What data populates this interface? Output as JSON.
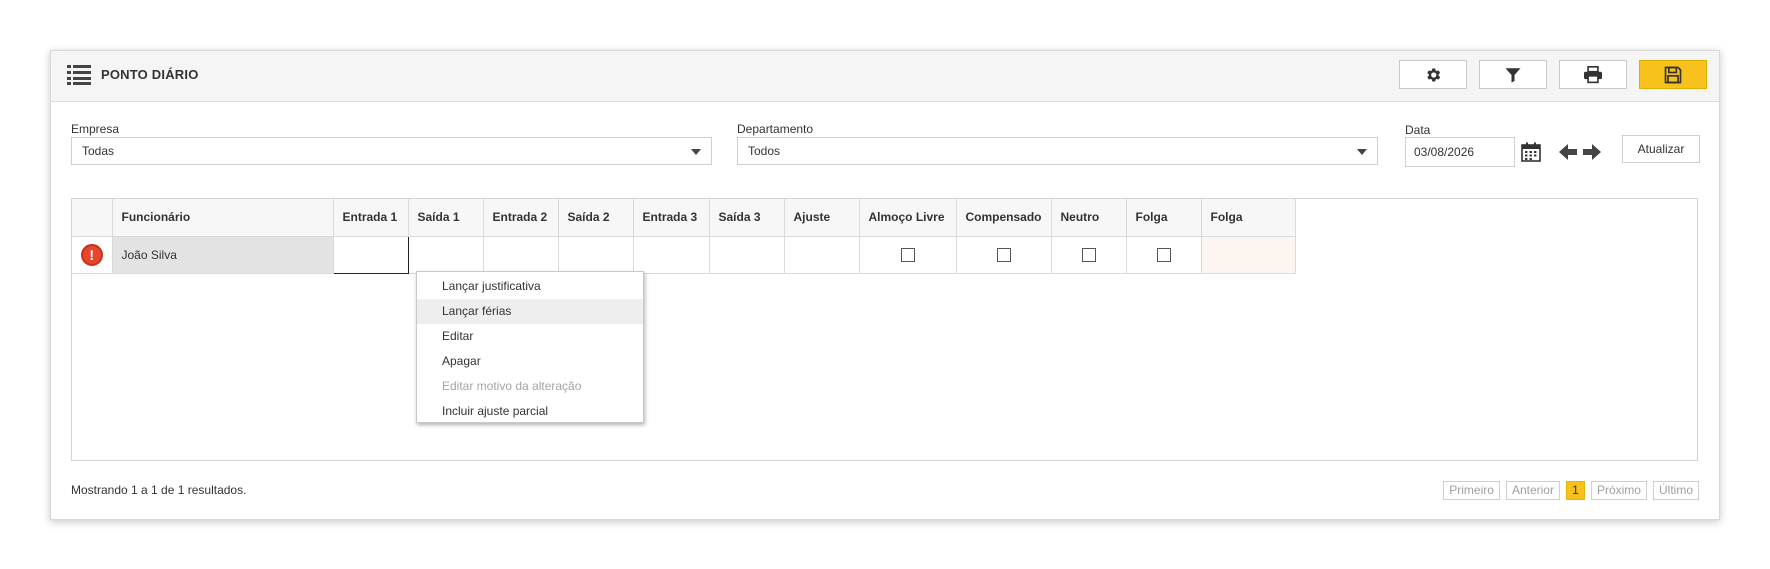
{
  "header": {
    "title": "PONTO DIÁRIO",
    "buttons": [
      {
        "icon": "gear-icon"
      },
      {
        "icon": "filter-icon"
      },
      {
        "icon": "print-icon"
      },
      {
        "icon": "save-icon"
      }
    ]
  },
  "filters": {
    "empresa": {
      "label": "Empresa",
      "value": "Todas"
    },
    "departamento": {
      "label": "Departamento",
      "value": "Todos"
    },
    "data": {
      "label": "Data",
      "value": "03/08/2026"
    },
    "refresh_label": "Atualizar"
  },
  "table": {
    "columns": [
      "",
      "Funcionário",
      "Entrada 1",
      "Saída 1",
      "Entrada 2",
      "Saída 2",
      "Entrada 3",
      "Saída 3",
      "Ajuste",
      "Almoço Livre",
      "Compensado",
      "Neutro",
      "Folga",
      "Folga"
    ],
    "rows": [
      {
        "status_icon": "alert-icon",
        "status_glyph": "!",
        "funcionario": "João Silva",
        "entrada1": "",
        "saida1": "",
        "entrada2": "",
        "saida2": "",
        "entrada3": "",
        "saida3": "",
        "ajuste": "",
        "almoco_livre": false,
        "compensado": false,
        "neutro": false,
        "folga": false,
        "folga2": ""
      }
    ]
  },
  "context_menu": {
    "items": [
      {
        "label": "Lançar justificativa",
        "state": "normal"
      },
      {
        "label": "Lançar férias",
        "state": "hover"
      },
      {
        "label": "Editar",
        "state": "normal"
      },
      {
        "label": "Apagar",
        "state": "normal"
      },
      {
        "label": "Editar motivo da alteração",
        "state": "disabled"
      },
      {
        "label": "Incluir ajuste parcial",
        "state": "normal"
      }
    ]
  },
  "footer": {
    "results_text": "Mostrando 1 a 1 de 1 resultados.",
    "pagination": {
      "first": "Primeiro",
      "prev": "Anterior",
      "current": "1",
      "next": "Próximo",
      "last": "Último"
    }
  },
  "colors": {
    "accent": "#f6c21b",
    "alert": "#e5462d",
    "peach": "#fdf5ef"
  }
}
